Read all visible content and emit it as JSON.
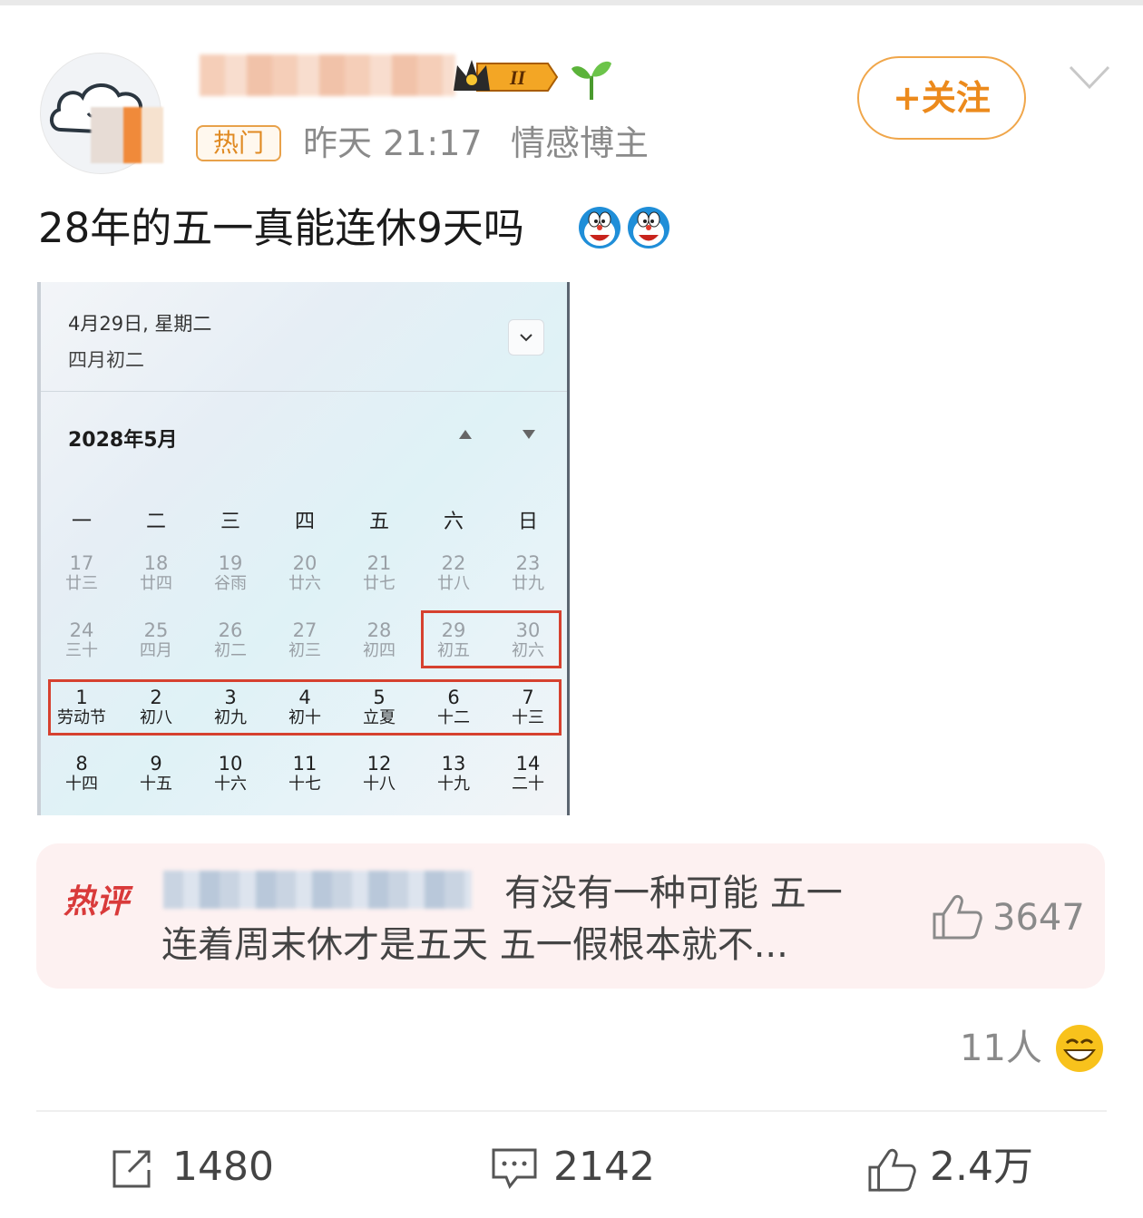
{
  "header": {
    "username": "",
    "hot_tag": "热门",
    "time": "昨天 21:17",
    "category": "情感博主",
    "follow_label": "+关注",
    "level_badge": "II"
  },
  "post": {
    "text": "28年的五一真能连休9天吗"
  },
  "calendar": {
    "selected_date": "4月29日, 星期二",
    "selected_lunar": "四月初二",
    "month_title": "2028年5月",
    "weekdays": [
      "一",
      "二",
      "三",
      "四",
      "五",
      "六",
      "日"
    ],
    "weeks": [
      [
        {
          "d": "17",
          "l": "廿三"
        },
        {
          "d": "18",
          "l": "廿四"
        },
        {
          "d": "19",
          "l": "谷雨"
        },
        {
          "d": "20",
          "l": "廿六"
        },
        {
          "d": "21",
          "l": "廿七"
        },
        {
          "d": "22",
          "l": "廿八"
        },
        {
          "d": "23",
          "l": "廿九"
        }
      ],
      [
        {
          "d": "24",
          "l": "三十"
        },
        {
          "d": "25",
          "l": "四月"
        },
        {
          "d": "26",
          "l": "初二"
        },
        {
          "d": "27",
          "l": "初三"
        },
        {
          "d": "28",
          "l": "初四"
        },
        {
          "d": "29",
          "l": "初五"
        },
        {
          "d": "30",
          "l": "初六"
        }
      ],
      [
        {
          "d": "1",
          "l": "劳动节"
        },
        {
          "d": "2",
          "l": "初八"
        },
        {
          "d": "3",
          "l": "初九"
        },
        {
          "d": "4",
          "l": "初十"
        },
        {
          "d": "5",
          "l": "立夏"
        },
        {
          "d": "6",
          "l": "十二"
        },
        {
          "d": "7",
          "l": "十三"
        }
      ],
      [
        {
          "d": "8",
          "l": "十四"
        },
        {
          "d": "9",
          "l": "十五"
        },
        {
          "d": "10",
          "l": "十六"
        },
        {
          "d": "11",
          "l": "十七"
        },
        {
          "d": "12",
          "l": "十八"
        },
        {
          "d": "13",
          "l": "十九"
        },
        {
          "d": "14",
          "l": "二十"
        }
      ]
    ]
  },
  "hot_comment": {
    "label": "热评",
    "line1": "有没有一种可能 五一",
    "line2": "连着周末休才是五天 五一假根本就不...",
    "likes": "3647"
  },
  "reactions": {
    "count": "11人"
  },
  "actions": {
    "share": "1480",
    "comment": "2142",
    "like": "2.4万"
  },
  "colors": {
    "accent": "#ec8a1c",
    "hot_red": "#d93a3a",
    "highlight_box": "#d6412f"
  }
}
